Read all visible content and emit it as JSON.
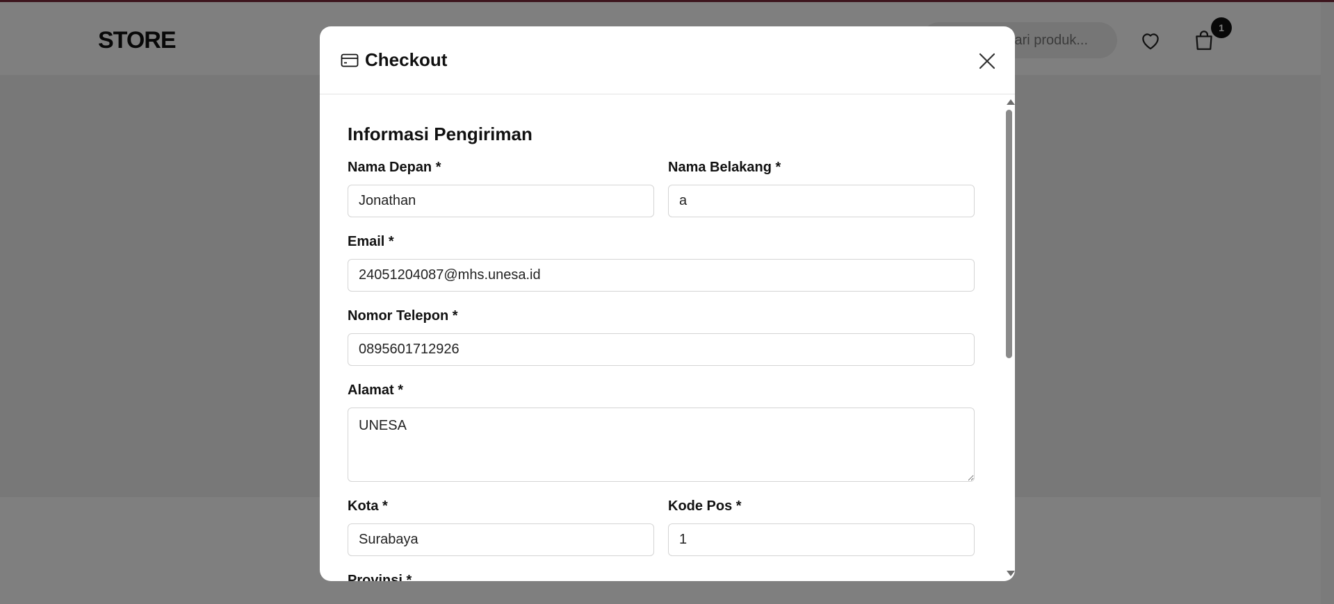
{
  "store": {
    "logo": "STORE",
    "search_placeholder": "Cari produk...",
    "cart_count": "1"
  },
  "modal": {
    "title": "Checkout",
    "section_title": "Informasi Pengiriman",
    "fields": {
      "first_name": {
        "label": "Nama Depan *",
        "value": "Jonathan"
      },
      "last_name": {
        "label": "Nama Belakang *",
        "value": "a"
      },
      "email": {
        "label": "Email *",
        "value": "24051204087@mhs.unesa.id"
      },
      "phone": {
        "label": "Nomor Telepon *",
        "value": "0895601712926"
      },
      "address": {
        "label": "Alamat *",
        "value": "UNESA"
      },
      "city": {
        "label": "Kota *",
        "value": "Surabaya"
      },
      "postal_code": {
        "label": "Kode Pos *",
        "value": "1"
      },
      "province": {
        "label": "Provinsi *"
      }
    }
  },
  "icons": {
    "checkout": "credit-card-icon",
    "close": "close-icon",
    "wishlist": "heart-icon",
    "cart": "shopping-bag-icon"
  },
  "colors": {
    "overlay": "rgba(0,0,0,0.5)",
    "accent_top_line": "#7a2a3a",
    "badge": "#111111"
  }
}
